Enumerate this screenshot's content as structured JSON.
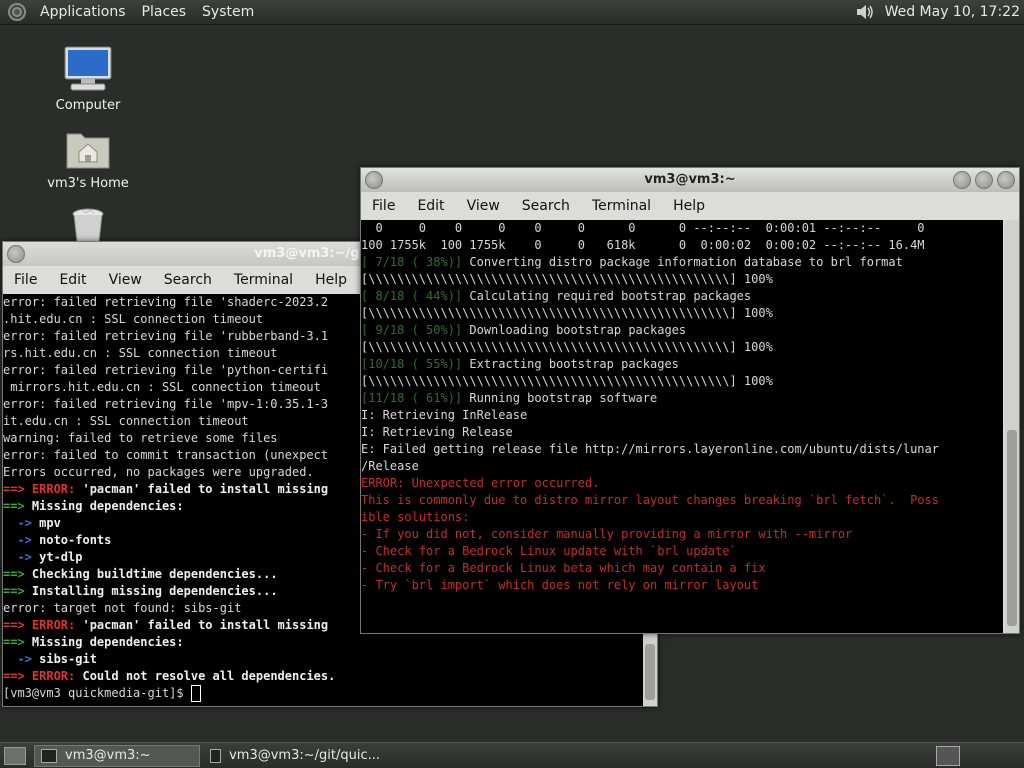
{
  "top_panel": {
    "menus": [
      "Applications",
      "Places",
      "System"
    ],
    "clock": "Wed May 10, 17:22"
  },
  "desktop_icons": [
    {
      "label": "Computer"
    },
    {
      "label": "vm3's Home"
    },
    {
      "label": ""
    }
  ],
  "window_back": {
    "title": "vm3@vm3:~/git/quic",
    "menu": [
      "File",
      "Edit",
      "View",
      "Search",
      "Terminal",
      "Help"
    ],
    "lines": [
      {
        "parts": [
          {
            "t": "error: failed retrieving file 'shaderc-2023.2",
            "c": ""
          }
        ]
      },
      {
        "parts": [
          {
            "t": ".hit.edu.cn : SSL connection timeout",
            "c": ""
          }
        ]
      },
      {
        "parts": [
          {
            "t": "error: failed retrieving file 'rubberband-3.1",
            "c": ""
          }
        ]
      },
      {
        "parts": [
          {
            "t": "rs.hit.edu.cn : SSL connection timeout",
            "c": ""
          }
        ]
      },
      {
        "parts": [
          {
            "t": "error: failed retrieving file 'python-certifi",
            "c": ""
          }
        ]
      },
      {
        "parts": [
          {
            "t": " mirrors.hit.edu.cn : SSL connection timeout",
            "c": ""
          }
        ]
      },
      {
        "parts": [
          {
            "t": "error: failed retrieving file 'mpv-1:0.35.1-3",
            "c": ""
          }
        ]
      },
      {
        "parts": [
          {
            "t": "it.edu.cn : SSL connection timeout",
            "c": ""
          }
        ]
      },
      {
        "parts": [
          {
            "t": "warning: failed to retrieve some files",
            "c": ""
          }
        ]
      },
      {
        "parts": [
          {
            "t": "error: failed to commit transaction (unexpect",
            "c": ""
          }
        ]
      },
      {
        "parts": [
          {
            "t": "Errors occurred, no packages were upgraded.",
            "c": ""
          }
        ]
      },
      {
        "parts": [
          {
            "t": "==> ",
            "c": "c-redbold"
          },
          {
            "t": "ERROR: ",
            "c": "c-redbold"
          },
          {
            "t": "'pacman' failed to install missing",
            "c": "c-bold"
          }
        ]
      },
      {
        "parts": [
          {
            "t": "==> ",
            "c": "c-greenbold"
          },
          {
            "t": "Missing dependencies:",
            "c": "c-bold"
          }
        ]
      },
      {
        "parts": [
          {
            "t": "  -> ",
            "c": "c-blue-bold"
          },
          {
            "t": "mpv",
            "c": "c-bold"
          }
        ]
      },
      {
        "parts": [
          {
            "t": "  -> ",
            "c": "c-blue-bold"
          },
          {
            "t": "noto-fonts",
            "c": "c-bold"
          }
        ]
      },
      {
        "parts": [
          {
            "t": "  -> ",
            "c": "c-blue-bold"
          },
          {
            "t": "yt-dlp",
            "c": "c-bold"
          }
        ]
      },
      {
        "parts": [
          {
            "t": "==> ",
            "c": "c-greenbold"
          },
          {
            "t": "Checking buildtime dependencies...",
            "c": "c-bold"
          }
        ]
      },
      {
        "parts": [
          {
            "t": "==> ",
            "c": "c-greenbold"
          },
          {
            "t": "Installing missing dependencies...",
            "c": "c-bold"
          }
        ]
      },
      {
        "parts": [
          {
            "t": "error: target not found: sibs-git",
            "c": ""
          }
        ]
      },
      {
        "parts": [
          {
            "t": "==> ",
            "c": "c-redbold"
          },
          {
            "t": "ERROR: ",
            "c": "c-redbold"
          },
          {
            "t": "'pacman' failed to install missing",
            "c": "c-bold"
          }
        ]
      },
      {
        "parts": [
          {
            "t": "==> ",
            "c": "c-greenbold"
          },
          {
            "t": "Missing dependencies:",
            "c": "c-bold"
          }
        ]
      },
      {
        "parts": [
          {
            "t": "  -> ",
            "c": "c-blue-bold"
          },
          {
            "t": "sibs-git",
            "c": "c-bold"
          }
        ]
      },
      {
        "parts": [
          {
            "t": "==> ",
            "c": "c-redbold"
          },
          {
            "t": "ERROR: ",
            "c": "c-redbold"
          },
          {
            "t": "Could not resolve all dependencies.",
            "c": "c-bold"
          }
        ]
      }
    ],
    "prompt": "[vm3@vm3 quickmedia-git]$ "
  },
  "window_front": {
    "title": "vm3@vm3:~",
    "menu": [
      "File",
      "Edit",
      "View",
      "Search",
      "Terminal",
      "Help"
    ],
    "lines": [
      {
        "parts": [
          {
            "t": "  0     0    0     0    0     0      0      0 --:--:--  0:00:01 --:--:--     0",
            "c": ""
          }
        ]
      },
      {
        "parts": [
          {
            "t": "100 1755k  100 1755k    0     0   618k      0  0:00:02  0:00:02 --:--:-- 16.4M",
            "c": ""
          }
        ]
      },
      {
        "parts": [
          {
            "t": "[ 7/18 ( 38%)] ",
            "c": "c-green"
          },
          {
            "t": "Converting distro package information database to brl format",
            "c": ""
          }
        ]
      },
      {
        "parts": [
          {
            "t": "[\\\\\\\\\\\\\\\\\\\\\\\\\\\\\\\\\\\\\\\\\\\\\\\\\\\\\\\\\\\\\\\\\\\\\\\\\\\\\\\\\\\\\\\\\\\\\\\\\\\\] 100%",
            "c": ""
          }
        ]
      },
      {
        "parts": [
          {
            "t": "[ 8/18 ( 44%)] ",
            "c": "c-green"
          },
          {
            "t": "Calculating required bootstrap packages",
            "c": ""
          }
        ]
      },
      {
        "parts": [
          {
            "t": "[\\\\\\\\\\\\\\\\\\\\\\\\\\\\\\\\\\\\\\\\\\\\\\\\\\\\\\\\\\\\\\\\\\\\\\\\\\\\\\\\\\\\\\\\\\\\\\\\\\\\] 100%",
            "c": ""
          }
        ]
      },
      {
        "parts": [
          {
            "t": "[ 9/18 ( 50%)] ",
            "c": "c-green"
          },
          {
            "t": "Downloading bootstrap packages",
            "c": ""
          }
        ]
      },
      {
        "parts": [
          {
            "t": "[\\\\\\\\\\\\\\\\\\\\\\\\\\\\\\\\\\\\\\\\\\\\\\\\\\\\\\\\\\\\\\\\\\\\\\\\\\\\\\\\\\\\\\\\\\\\\\\\\\\\] 100%",
            "c": ""
          }
        ]
      },
      {
        "parts": [
          {
            "t": "[10/18 ( 55%)] ",
            "c": "c-green"
          },
          {
            "t": "Extracting bootstrap packages",
            "c": ""
          }
        ]
      },
      {
        "parts": [
          {
            "t": "[\\\\\\\\\\\\\\\\\\\\\\\\\\\\\\\\\\\\\\\\\\\\\\\\\\\\\\\\\\\\\\\\\\\\\\\\\\\\\\\\\\\\\\\\\\\\\\\\\\\\] 100%",
            "c": ""
          }
        ]
      },
      {
        "parts": [
          {
            "t": "[11/18 ( 61%)] ",
            "c": "c-green"
          },
          {
            "t": "Running bootstrap software",
            "c": ""
          }
        ]
      },
      {
        "parts": [
          {
            "t": "I: Retrieving InRelease",
            "c": ""
          }
        ]
      },
      {
        "parts": [
          {
            "t": "I: Retrieving Release",
            "c": ""
          }
        ]
      },
      {
        "parts": [
          {
            "t": "E: Failed getting release file http://mirrors.layeronline.com/ubuntu/dists/lunar",
            "c": ""
          }
        ]
      },
      {
        "parts": [
          {
            "t": "/Release",
            "c": ""
          }
        ]
      },
      {
        "parts": [
          {
            "t": "ERROR: Unexpected error occurred.",
            "c": "c-red"
          }
        ]
      },
      {
        "parts": [
          {
            "t": "This is commonly due to distro mirror layout changes breaking `brl fetch`.  Poss",
            "c": "c-red"
          }
        ]
      },
      {
        "parts": [
          {
            "t": "ible solutions:",
            "c": "c-red"
          }
        ]
      },
      {
        "parts": [
          {
            "t": "- If you did not, consider manually providing a mirror with --mirror",
            "c": "c-red"
          }
        ]
      },
      {
        "parts": [
          {
            "t": "- Check for a Bedrock Linux update with `brl update`",
            "c": "c-red"
          }
        ]
      },
      {
        "parts": [
          {
            "t": "- Check for a Bedrock Linux beta which may contain a fix",
            "c": "c-red"
          }
        ]
      },
      {
        "parts": [
          {
            "t": "- Try `brl import` which does not rely on mirror layout",
            "c": "c-red"
          }
        ]
      }
    ]
  },
  "taskbar": {
    "tasks": [
      {
        "label": "vm3@vm3:~",
        "active": true
      },
      {
        "label": "vm3@vm3:~/git/quic...",
        "active": false
      }
    ]
  }
}
